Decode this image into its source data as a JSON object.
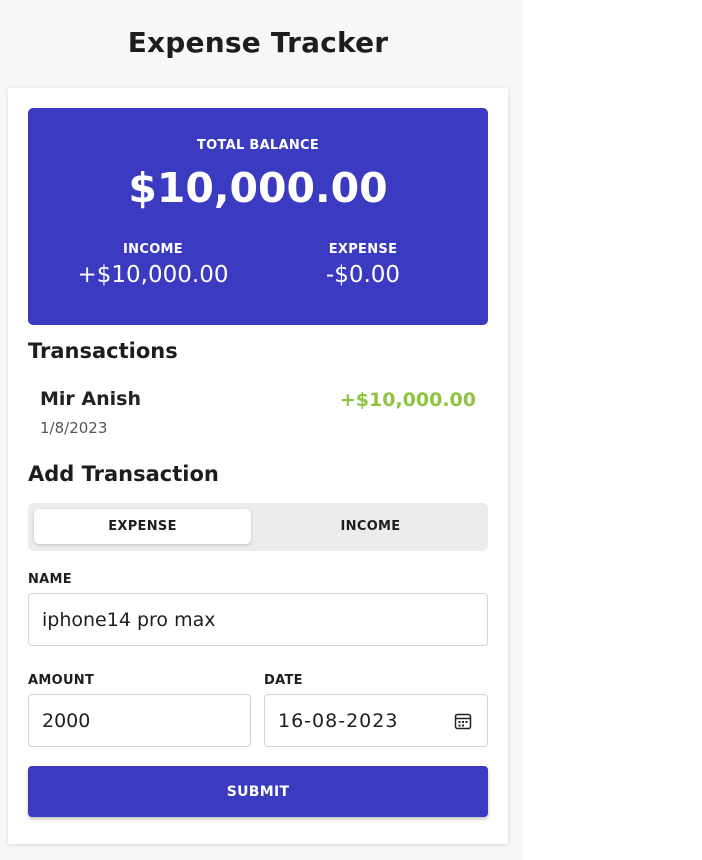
{
  "app": {
    "title": "Expense Tracker"
  },
  "balance": {
    "label": "TOTAL BALANCE",
    "amount": "$10,000.00",
    "income_label": "INCOME",
    "income_value": "+$10,000.00",
    "expense_label": "EXPENSE",
    "expense_value": "-$0.00",
    "color": "#3a3bc0"
  },
  "transactions": {
    "heading": "Transactions",
    "items": [
      {
        "name": "Mir Anish",
        "date": "1/8/2023",
        "amount": "+$10,000.00",
        "amount_color": "#8fc442"
      }
    ]
  },
  "add_transaction": {
    "heading": "Add Transaction",
    "toggle": {
      "selected": "EXPENSE",
      "options": [
        "EXPENSE",
        "INCOME"
      ]
    },
    "name_label": "NAME",
    "name_value": "iphone14 pro max",
    "amount_label": "AMOUNT",
    "amount_value": "2000",
    "date_label": "DATE",
    "date_value": "16-08-2023",
    "date_icon": "calendar-icon",
    "submit_label": "SUBMIT"
  }
}
